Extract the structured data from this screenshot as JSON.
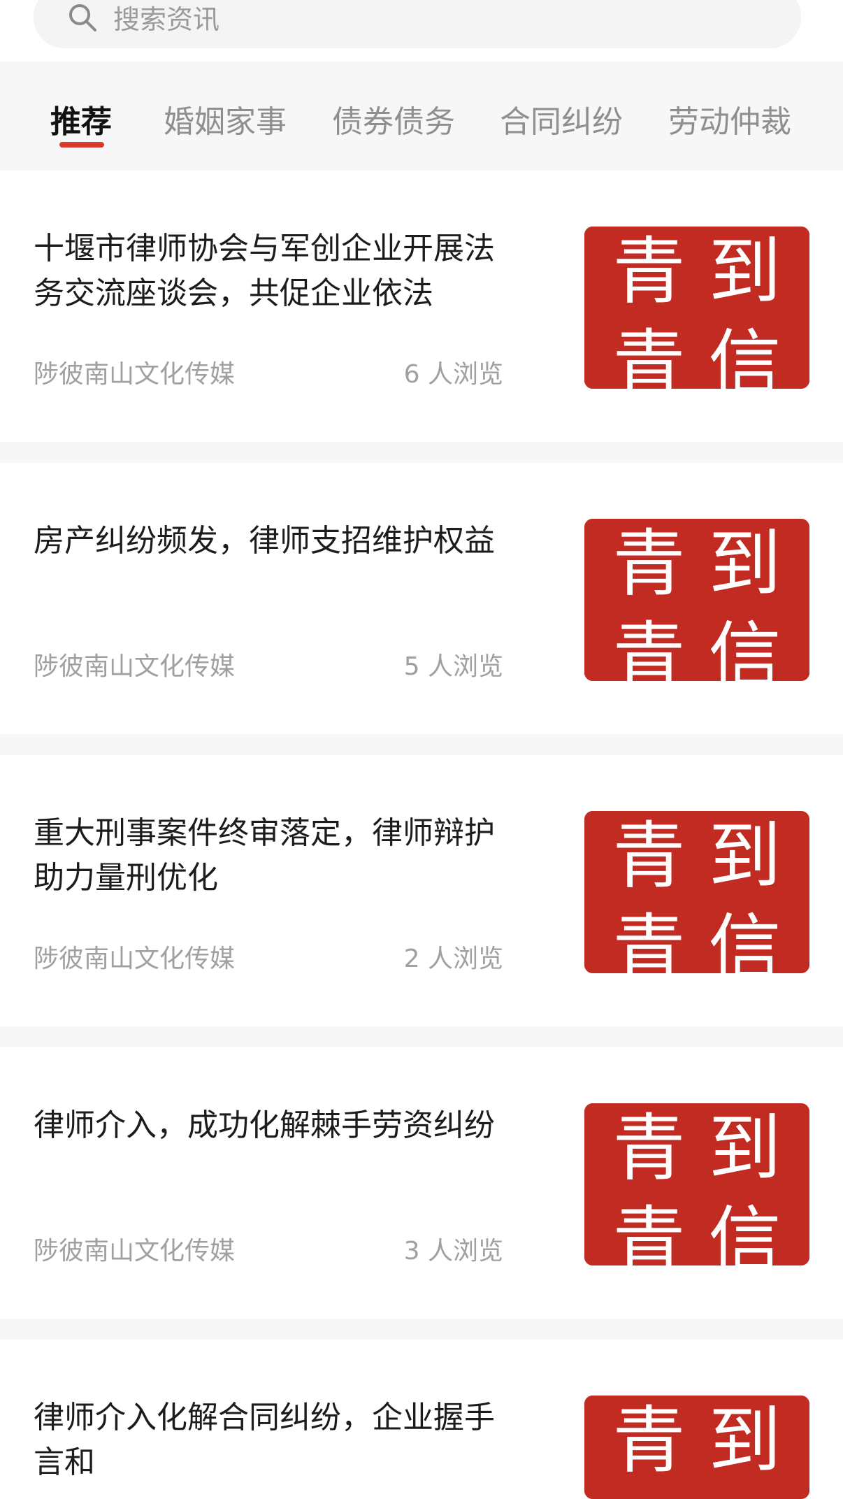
{
  "search": {
    "placeholder": "搜索资讯"
  },
  "tabs": [
    {
      "label": "推荐",
      "active": true
    },
    {
      "label": "婚姻家事",
      "active": false
    },
    {
      "label": "债券债务",
      "active": false
    },
    {
      "label": "合同纠纷",
      "active": false
    },
    {
      "label": "劳动仲裁",
      "active": false
    }
  ],
  "colors": {
    "accent": "#d93a2b",
    "thumb_bg": "#c22b21",
    "thumb_text": "#ffffff"
  },
  "thumbnail": {
    "text_top": "青 到",
    "text_bottom": "青 信"
  },
  "articles": [
    {
      "title": "十堰市律师协会与军创企业开展法务交流座谈会，共促企业依法",
      "source": "陟彼南山文化传媒",
      "views": "6 人浏览"
    },
    {
      "title": "房产纠纷频发，律师支招维护权益",
      "source": "陟彼南山文化传媒",
      "views": "5 人浏览"
    },
    {
      "title": "重大刑事案件终审落定，律师辩护助力量刑优化",
      "source": "陟彼南山文化传媒",
      "views": "2 人浏览"
    },
    {
      "title": "律师介入，成功化解棘手劳资纠纷",
      "source": "陟彼南山文化传媒",
      "views": "3 人浏览"
    },
    {
      "title": "律师介入化解合同纠纷，企业握手言和",
      "source": "",
      "views": ""
    }
  ]
}
